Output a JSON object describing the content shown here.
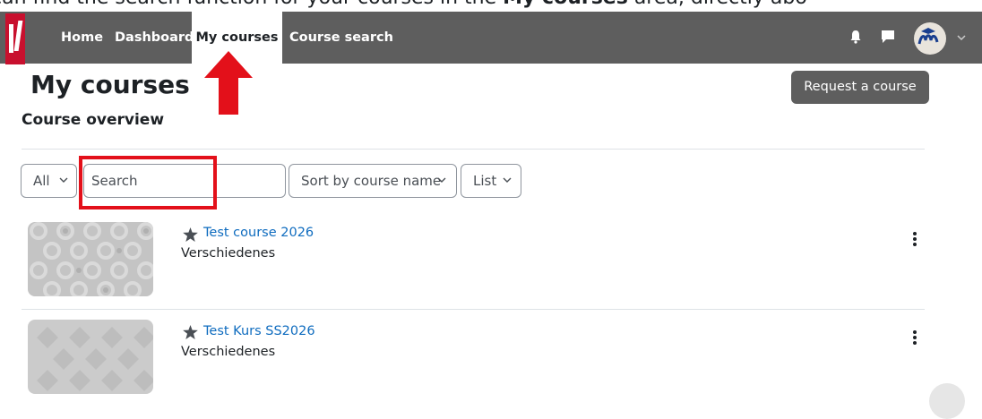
{
  "caption": {
    "text_before": "can find the search function for your courses in the ",
    "text_bold": "My courses",
    "text_after": " area, directly abo"
  },
  "navbar": {
    "items": [
      {
        "label": "Home"
      },
      {
        "label": "Dashboard"
      },
      {
        "label": "My courses"
      },
      {
        "label": "Course search"
      }
    ],
    "active_index": 2,
    "background": "#5e5e5e",
    "icons": [
      "bell-icon",
      "chat-icon",
      "user-avatar",
      "chevron-down-icon"
    ]
  },
  "page": {
    "title": "My courses",
    "request_button": "Request a course",
    "section_title": "Course overview"
  },
  "filters": {
    "grouping": "All",
    "search_placeholder": "Search",
    "sort": "Sort by course name",
    "view": "List"
  },
  "courses": [
    {
      "name": "Test course 2026",
      "category": "Verschiedenes",
      "starred": true
    },
    {
      "name": "Test Kurs SS2026",
      "category": "Verschiedenes",
      "starred": true
    }
  ],
  "colors": {
    "accent_link": "#0f6cbf",
    "highlight_red": "#e3101a",
    "brand_red": "#c8102e"
  }
}
